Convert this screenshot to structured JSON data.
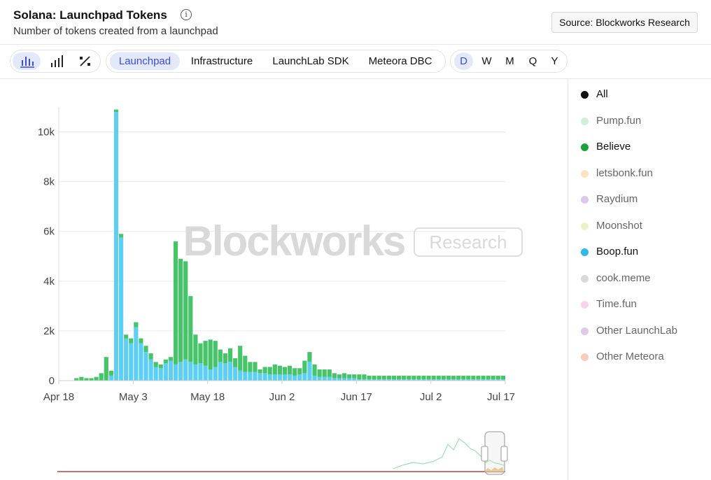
{
  "header": {
    "title": "Solana: Launchpad Tokens",
    "subtitle": "Number of tokens created from a launchpad",
    "info_icon": "info-icon",
    "source_label": "Source: Blockworks Research"
  },
  "toolbar": {
    "chart_types": [
      {
        "name": "bar-chart-icon",
        "active": true
      },
      {
        "name": "bar-ascending-icon",
        "active": false
      },
      {
        "name": "percent-icon",
        "active": false
      }
    ],
    "categories": [
      {
        "label": "Launchpad",
        "active": true
      },
      {
        "label": "Infrastructure",
        "active": false
      },
      {
        "label": "LaunchLab SDK",
        "active": false
      },
      {
        "label": "Meteora DBC",
        "active": false
      }
    ],
    "intervals": [
      {
        "label": "D",
        "active": true
      },
      {
        "label": "W",
        "active": false
      },
      {
        "label": "M",
        "active": false
      },
      {
        "label": "Q",
        "active": false
      },
      {
        "label": "Y",
        "active": false
      }
    ]
  },
  "legend": [
    {
      "label": "All",
      "color": "#111111",
      "enabled": true
    },
    {
      "label": "Pump.fun",
      "color": "#cfeedd",
      "enabled": false
    },
    {
      "label": "Believe",
      "color": "#1aa33c",
      "enabled": true
    },
    {
      "label": "letsbonk.fun",
      "color": "#fbe3c4",
      "enabled": false
    },
    {
      "label": "Raydium",
      "color": "#dcc8ec",
      "enabled": false
    },
    {
      "label": "Moonshot",
      "color": "#eef1c8",
      "enabled": false
    },
    {
      "label": "Boop.fun",
      "color": "#2fbbe8",
      "enabled": true
    },
    {
      "label": "cook.meme",
      "color": "#d9d9d9",
      "enabled": false
    },
    {
      "label": "Time.fun",
      "color": "#f7d3ec",
      "enabled": false
    },
    {
      "label": "Other LaunchLab",
      "color": "#ddc9ea",
      "enabled": false
    },
    {
      "label": "Other Meteora",
      "color": "#f8cdbd",
      "enabled": false
    }
  ],
  "watermark": {
    "brand": "Blockworks",
    "tag": "Research"
  },
  "colors": {
    "believe": "#47c46a",
    "boop": "#5dcff2",
    "grid": "#e9e9e9",
    "axis_text": "#444444"
  },
  "chart_data": {
    "type": "bar",
    "stacked": true,
    "title": "Solana: Launchpad Tokens",
    "xlabel": "",
    "ylabel": "",
    "x_start": "2025-04-18",
    "x_end": "2025-07-17",
    "x_ticks": [
      "Apr 18",
      "May 3",
      "May 18",
      "Jun 2",
      "Jun 17",
      "Jul 2",
      "Jul 17"
    ],
    "y_ticks": [
      "0",
      "2k",
      "4k",
      "6k",
      "8k",
      "10k"
    ],
    "ylim": [
      0,
      11000
    ],
    "grid": true,
    "legend_position": "right",
    "categories": [
      "2025-04-22",
      "2025-04-23",
      "2025-04-24",
      "2025-04-25",
      "2025-04-26",
      "2025-04-27",
      "2025-04-28",
      "2025-04-29",
      "2025-04-30",
      "2025-05-01",
      "2025-05-02",
      "2025-05-03",
      "2025-05-04",
      "2025-05-05",
      "2025-05-06",
      "2025-05-07",
      "2025-05-08",
      "2025-05-09",
      "2025-05-10",
      "2025-05-11",
      "2025-05-12",
      "2025-05-13",
      "2025-05-14",
      "2025-05-15",
      "2025-05-16",
      "2025-05-17",
      "2025-05-18",
      "2025-05-19",
      "2025-05-20",
      "2025-05-21",
      "2025-05-22",
      "2025-05-23",
      "2025-05-24",
      "2025-05-25",
      "2025-05-26",
      "2025-05-27",
      "2025-05-28",
      "2025-05-29",
      "2025-05-30",
      "2025-05-31",
      "2025-06-01",
      "2025-06-02",
      "2025-06-03",
      "2025-06-04",
      "2025-06-05",
      "2025-06-06",
      "2025-06-07",
      "2025-06-08",
      "2025-06-09",
      "2025-06-10",
      "2025-06-11",
      "2025-06-12",
      "2025-06-13",
      "2025-06-14",
      "2025-06-15",
      "2025-06-16",
      "2025-06-17",
      "2025-06-18",
      "2025-06-19",
      "2025-06-20",
      "2025-06-21",
      "2025-06-22",
      "2025-06-23",
      "2025-06-24",
      "2025-06-25",
      "2025-06-26",
      "2025-06-27",
      "2025-06-28",
      "2025-06-29",
      "2025-06-30",
      "2025-07-01",
      "2025-07-02",
      "2025-07-03",
      "2025-07-04",
      "2025-07-05",
      "2025-07-06",
      "2025-07-07",
      "2025-07-08",
      "2025-07-09",
      "2025-07-10",
      "2025-07-11",
      "2025-07-12",
      "2025-07-13",
      "2025-07-14",
      "2025-07-15",
      "2025-07-16",
      "2025-07-17"
    ],
    "series": [
      {
        "name": "Boop.fun",
        "color": "#5dcff2",
        "values": [
          0,
          0,
          0,
          0,
          0,
          0,
          0,
          200,
          10800,
          5750,
          1700,
          1500,
          2150,
          1500,
          1150,
          850,
          550,
          500,
          700,
          800,
          650,
          750,
          850,
          750,
          650,
          700,
          600,
          450,
          550,
          750,
          700,
          750,
          550,
          400,
          350,
          350,
          350,
          300,
          300,
          250,
          250,
          250,
          250,
          250,
          200,
          250,
          300,
          750,
          200,
          150,
          150,
          150,
          100,
          100,
          100,
          100,
          100,
          50,
          50,
          50,
          50,
          50,
          50,
          50,
          50,
          50,
          50,
          50,
          50,
          50,
          50,
          50,
          50,
          50,
          50,
          50,
          50,
          50,
          50,
          50,
          50,
          50,
          50,
          50,
          50,
          50,
          50
        ]
      },
      {
        "name": "Believe",
        "color": "#47c46a",
        "values": [
          100,
          150,
          100,
          100,
          150,
          300,
          950,
          200,
          100,
          150,
          150,
          200,
          200,
          200,
          250,
          250,
          200,
          150,
          150,
          150,
          4950,
          4150,
          3950,
          2650,
          1200,
          800,
          1000,
          1200,
          1050,
          500,
          400,
          550,
          350,
          1000,
          650,
          400,
          400,
          150,
          250,
          300,
          400,
          350,
          300,
          350,
          300,
          250,
          500,
          400,
          450,
          300,
          300,
          300,
          200,
          150,
          200,
          150,
          150,
          200,
          200,
          150,
          150,
          150,
          150,
          150,
          150,
          150,
          150,
          150,
          150,
          150,
          150,
          150,
          150,
          150,
          150,
          150,
          150,
          150,
          150,
          150,
          150,
          150,
          150,
          150,
          150,
          150,
          150
        ]
      }
    ]
  }
}
